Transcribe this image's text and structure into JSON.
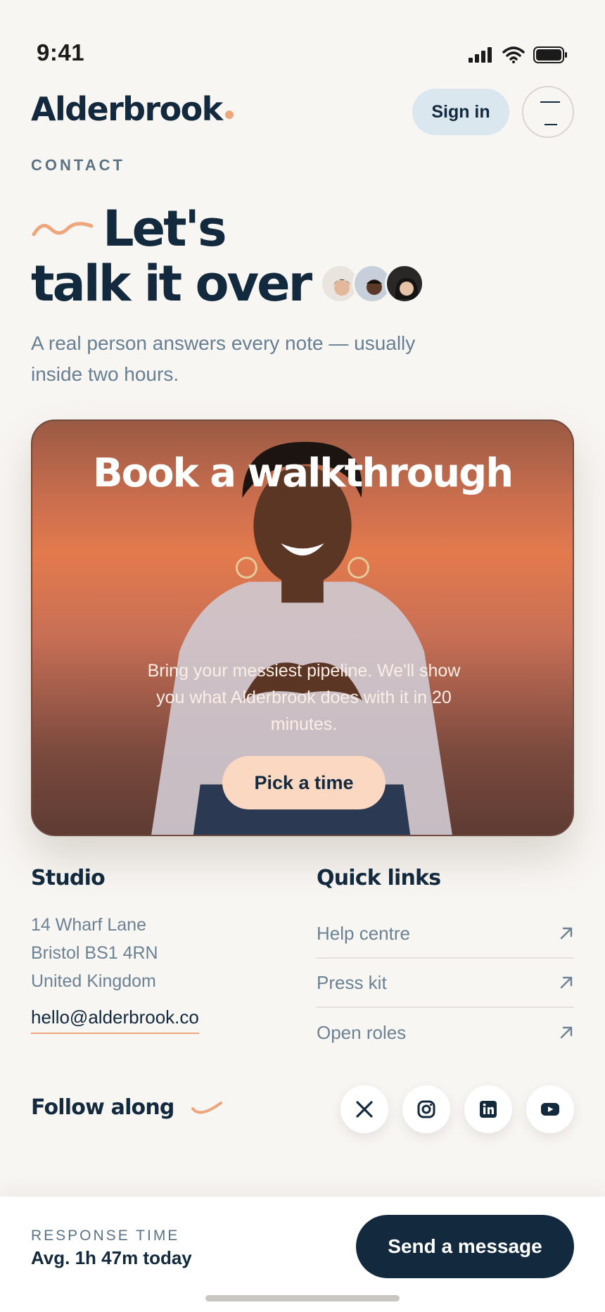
{
  "status_bar": {
    "time": "9:41",
    "icons": [
      "signal-icon",
      "wifi-icon",
      "battery-icon"
    ]
  },
  "header": {
    "brand": "Alderbrook",
    "signin_label": "Sign in",
    "menu_icon": "menu-icon"
  },
  "page": {
    "eyebrow": "CONTACT",
    "headline_line1": "Let's",
    "headline_line2": "talk it over",
    "subtitle": "A real person answers every note — usually inside two hours."
  },
  "hero": {
    "title": "Book a walkthrough",
    "text": "Bring your messiest pipeline. We'll show you what Alderbrook does with it in 20 minutes.",
    "button_label": "Pick a time"
  },
  "studio": {
    "title": "Studio",
    "address": [
      "14 Wharf Lane",
      "Bristol BS1 4RN",
      "United Kingdom"
    ],
    "email": "hello@alderbrook.co"
  },
  "quick_links": {
    "title": "Quick links",
    "items": [
      {
        "label": "Help centre"
      },
      {
        "label": "Press kit"
      },
      {
        "label": "Open roles"
      }
    ]
  },
  "follow": {
    "title": "Follow along",
    "socials": [
      "x-icon",
      "instagram-icon",
      "linkedin-icon",
      "youtube-icon"
    ]
  },
  "bottom_bar": {
    "label": "RESPONSE TIME",
    "value": "Avg. 1h 47m today",
    "button_label": "Send a message"
  },
  "colors": {
    "navy": "#13293d",
    "accent": "#eea67d",
    "background": "#f8f6f3",
    "hero_orange": "#e37a4d"
  }
}
